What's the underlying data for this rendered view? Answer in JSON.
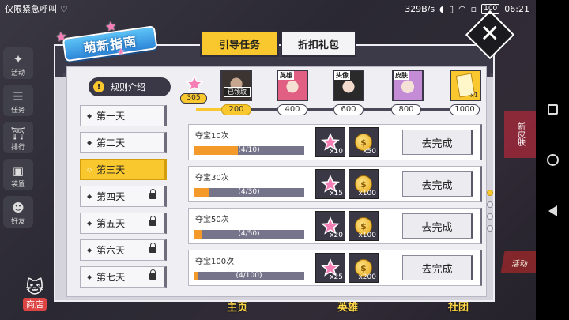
{
  "status_bar": {
    "left_text": "仅限紧急呼叫",
    "speed": "329B/s",
    "battery": "100",
    "time": "06:21"
  },
  "background": {
    "side_menu": [
      {
        "label": "活动",
        "icon": "megaphone-icon"
      },
      {
        "label": "任务",
        "icon": "list-icon"
      },
      {
        "label": "排行",
        "icon": "gate-icon"
      },
      {
        "label": "装置",
        "icon": "bag-icon"
      },
      {
        "label": "好友",
        "icon": "doll-icon"
      }
    ],
    "shop_label": "商店",
    "bottom_tabs": [
      "主页",
      "英雄",
      "社团"
    ],
    "promo_right": "新皮肤",
    "promo_right2": "活动"
  },
  "dialog": {
    "title": "萌新指南",
    "tabs": [
      {
        "label": "引导任务",
        "active": true
      },
      {
        "label": "折扣礼包",
        "active": false
      }
    ],
    "rules_label": "规则介绍",
    "days": [
      {
        "label": "第一天",
        "state": "done"
      },
      {
        "label": "第二天",
        "state": "done"
      },
      {
        "label": "第三天",
        "state": "active"
      },
      {
        "label": "第四天",
        "state": "locked"
      },
      {
        "label": "第五天",
        "state": "locked"
      },
      {
        "label": "第六天",
        "state": "locked"
      },
      {
        "label": "第七天",
        "state": "locked"
      }
    ],
    "progress": {
      "points": "305",
      "milestones": [
        "200",
        "400",
        "600",
        "800",
        "1000"
      ],
      "rewards": [
        {
          "tag": "",
          "claimed_label": "已领取"
        },
        {
          "tag": "英雄"
        },
        {
          "tag": "头像"
        },
        {
          "tag": "皮肤"
        },
        {
          "quantity": "x1"
        }
      ]
    },
    "tasks": [
      {
        "name": "夺宝10次",
        "progress_text": "(4/10)",
        "progress": 0.4,
        "reward1_qty": "x10",
        "reward2_qty": "x50",
        "button": "去完成"
      },
      {
        "name": "夺宝30次",
        "progress_text": "(4/30)",
        "progress": 0.133,
        "reward1_qty": "x15",
        "reward2_qty": "x100",
        "button": "去完成"
      },
      {
        "name": "夺宝50次",
        "progress_text": "(4/50)",
        "progress": 0.08,
        "reward1_qty": "x20",
        "reward2_qty": "x100",
        "button": "去完成"
      },
      {
        "name": "夺宝100次",
        "progress_text": "(4/100)",
        "progress": 0.04,
        "reward1_qty": "x25",
        "reward2_qty": "x200",
        "button": "去完成"
      }
    ],
    "pages": {
      "current": 1,
      "total": 4
    }
  },
  "colors": {
    "accent_yellow": "#f9c72e",
    "progress_orange": "#f39a2a",
    "dark_panel": "#3c3948",
    "title_blue": "#2c86d8"
  }
}
